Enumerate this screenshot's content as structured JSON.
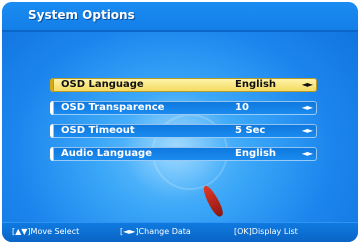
{
  "header": {
    "title": "System Options"
  },
  "menu": {
    "items": [
      {
        "label": "OSD Language",
        "value": "English",
        "arrows": "◄►",
        "selected": true
      },
      {
        "label": "OSD Transparence",
        "value": "10",
        "arrows": "◄►",
        "selected": false
      },
      {
        "label": "OSD Timeout",
        "value": "5 Sec",
        "arrows": "◄►",
        "selected": false
      },
      {
        "label": "Audio Language",
        "value": "English",
        "arrows": "◄►",
        "selected": false
      }
    ]
  },
  "footer": {
    "hints": [
      {
        "text": "[▲▼]Move Select"
      },
      {
        "text": "[◄►]Change Data"
      },
      {
        "text": "[OK]Display List"
      }
    ]
  },
  "colors": {
    "panel_blue": "#1c86ee",
    "selected_bg": "#f4d85a",
    "item_bg": "#0d77dd",
    "text_white": "#ffffff"
  }
}
